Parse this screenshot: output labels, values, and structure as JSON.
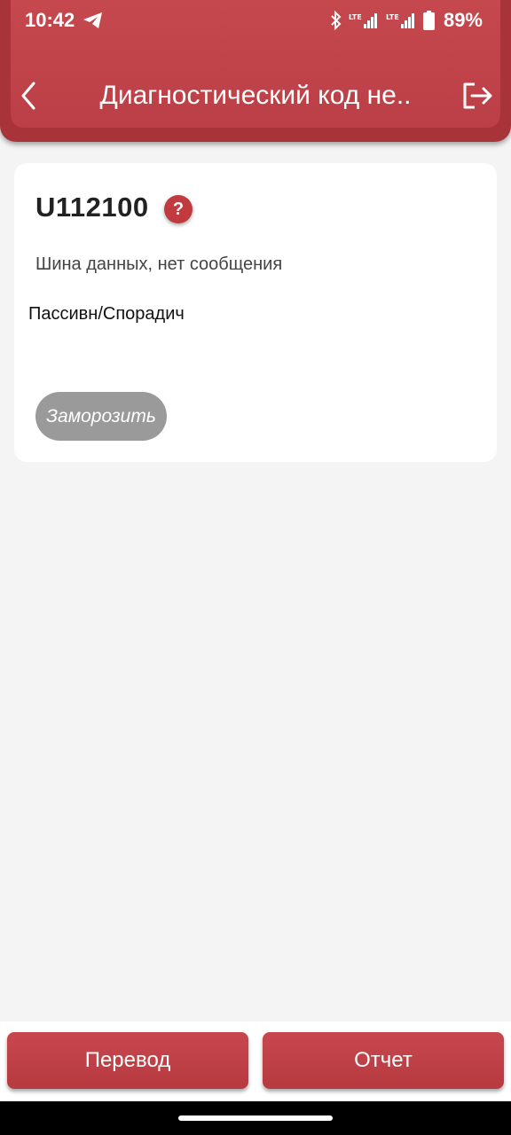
{
  "status_bar": {
    "time": "10:42",
    "battery": "89%",
    "icons": [
      "telegram-icon",
      "bluetooth-icon",
      "lte-signal-icon",
      "lte-signal-icon",
      "battery-icon"
    ]
  },
  "header": {
    "title": "Диагностический код не..",
    "back_icon": "chevron-left-icon",
    "exit_icon": "exit-icon"
  },
  "card": {
    "code": "U112100",
    "help_icon_label": "?",
    "description": "Шина данных, нет сообщения",
    "status": "Пассивн/Спорадич",
    "freeze_button": "Заморозить"
  },
  "bottom": {
    "translate_button": "Перевод",
    "report_button": "Отчет"
  },
  "colors": {
    "accent": "#c0393f",
    "card_bg": "#ffffff",
    "page_bg": "#f4f4f4",
    "freeze_button_bg": "#9a9a9a"
  }
}
